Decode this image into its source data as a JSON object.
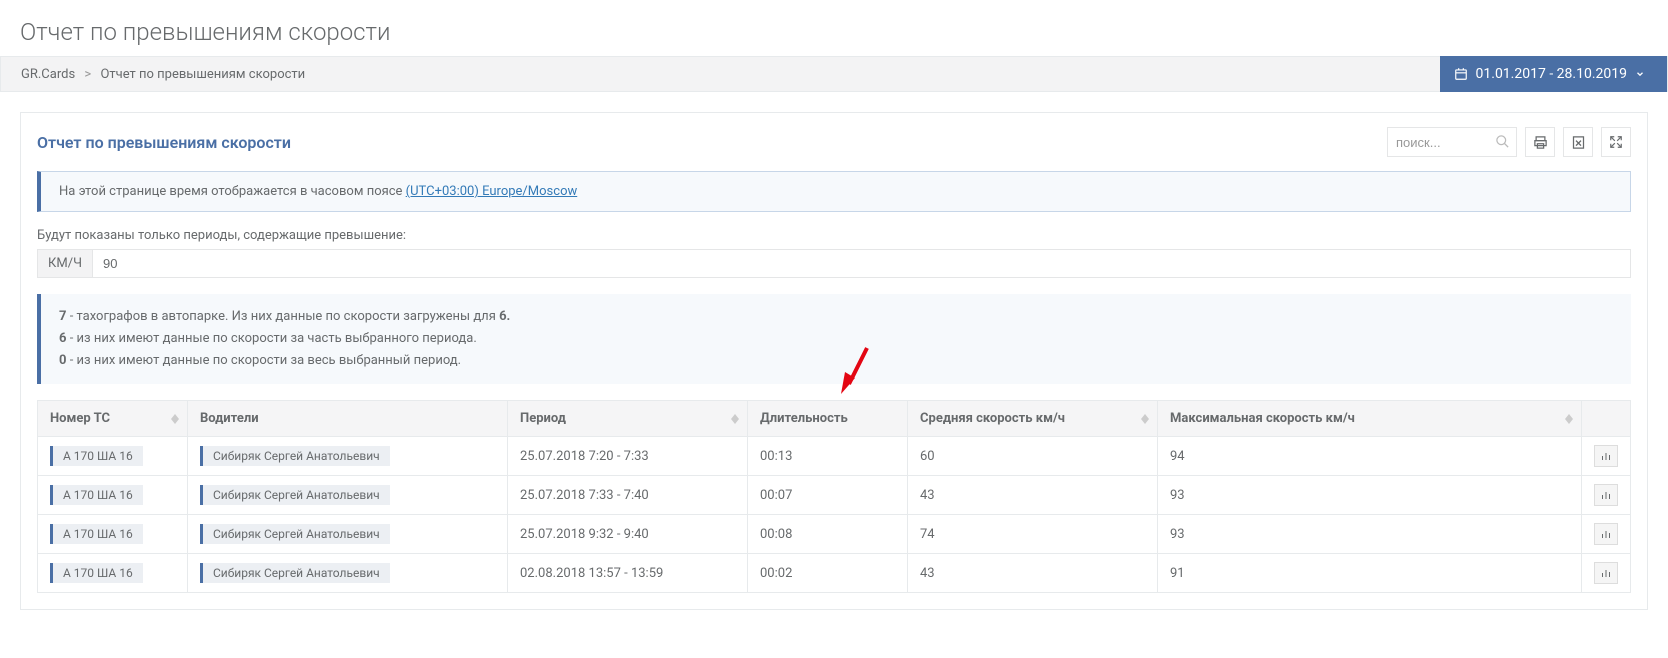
{
  "page_title": "Отчет по превышениям скорости",
  "breadcrumb": {
    "root": "GR.Cards",
    "sep": ">",
    "current": "Отчет по превышениям скорости"
  },
  "date_range": "01.01.2017 - 28.10.2019",
  "panel_title": "Отчет по превышениям скорости",
  "search_placeholder": "поиск...",
  "tz_note_prefix": "На этой странице время отображается в часовом поясе ",
  "tz_link": "(UTC+03:00) Europe/Moscow",
  "filter_label": "Будут показаны только периоды, содержащие превышение:",
  "speed_unit": "КМ/Ч",
  "speed_value": "90",
  "summary": {
    "tach_count": "7",
    "tach_text": " - тахографов в автопарке. Из них данные по скорости загружены для ",
    "tach_loaded": "6.",
    "part_count": "6",
    "part_text": " - из них имеют данные по скорости за часть выбранного периода.",
    "full_count": "0",
    "full_text": " - из них имеют данные по скорости за весь выбранный период."
  },
  "columns": {
    "vehicle": "Номер ТС",
    "drivers": "Водители",
    "period": "Период",
    "duration": "Длительность",
    "avg": "Средняя скорость км/ч",
    "max": "Максимальная скорость км/ч"
  },
  "rows": [
    {
      "vehicle": "А 170 ША 16",
      "driver": "Сибиряк Сергей Анатольевич",
      "period": "25.07.2018 7:20 - 7:33",
      "duration": "00:13",
      "avg": "60",
      "max": "94"
    },
    {
      "vehicle": "А 170 ША 16",
      "driver": "Сибиряк Сергей Анатольевич",
      "period": "25.07.2018 7:33 - 7:40",
      "duration": "00:07",
      "avg": "43",
      "max": "93"
    },
    {
      "vehicle": "А 170 ША 16",
      "driver": "Сибиряк Сергей Анатольевич",
      "period": "25.07.2018 9:32 - 9:40",
      "duration": "00:08",
      "avg": "74",
      "max": "93"
    },
    {
      "vehicle": "А 170 ША 16",
      "driver": "Сибиряк Сергей Анатольевич",
      "period": "02.08.2018 13:57 - 13:59",
      "duration": "00:02",
      "avg": "43",
      "max": "91"
    }
  ]
}
